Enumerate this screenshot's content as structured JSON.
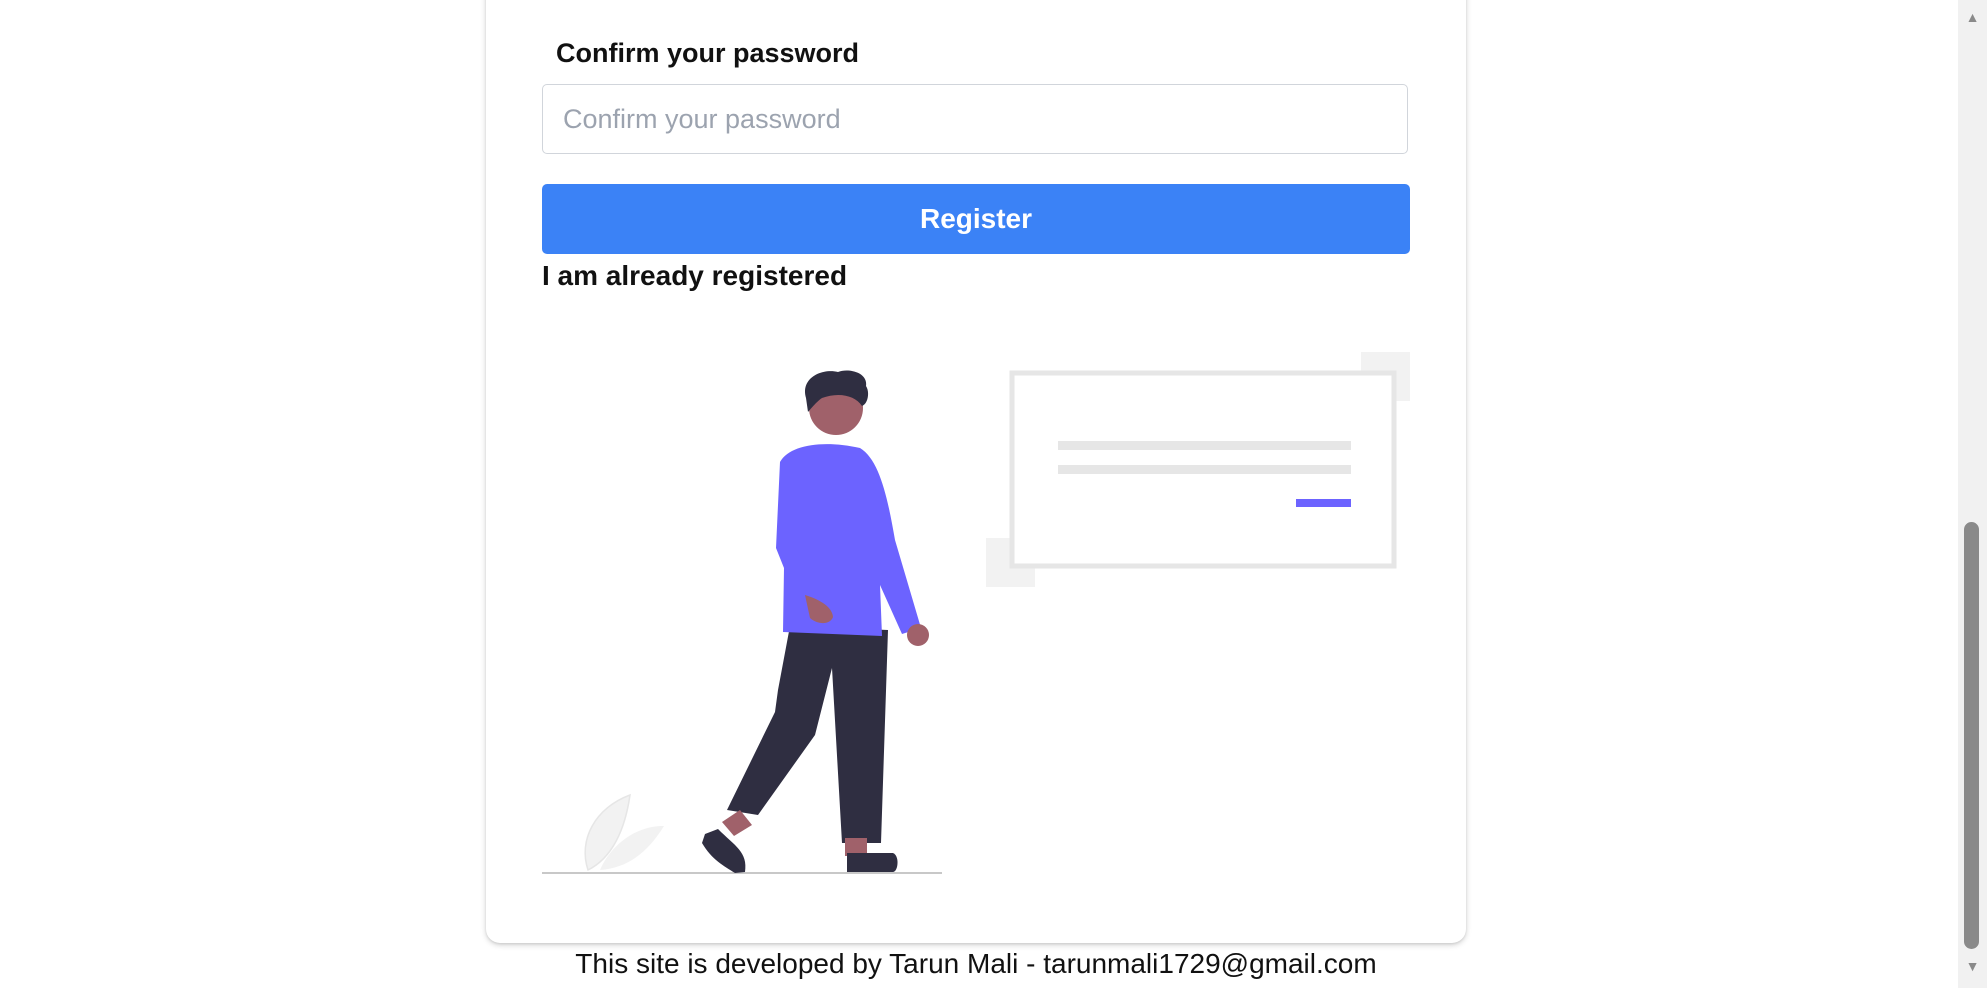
{
  "form": {
    "confirm_label": "Confirm your password",
    "confirm_placeholder": "Confirm your password",
    "confirm_value": "",
    "register_label": "Register",
    "login_link": "I am already registered"
  },
  "illustration": {
    "icon": "person-with-sign-in-card-illustration",
    "accent_color": "#6c63ff",
    "skin_color": "#a0616a",
    "dark_color": "#2f2e41",
    "neutral_color": "#e6e6e6"
  },
  "footer": {
    "text": "This site is developed by Tarun Mali - tarunmali1729@gmail.com"
  },
  "colors": {
    "primary": "#3b82f6",
    "scrollbar_thumb": "#8a8a8a"
  }
}
